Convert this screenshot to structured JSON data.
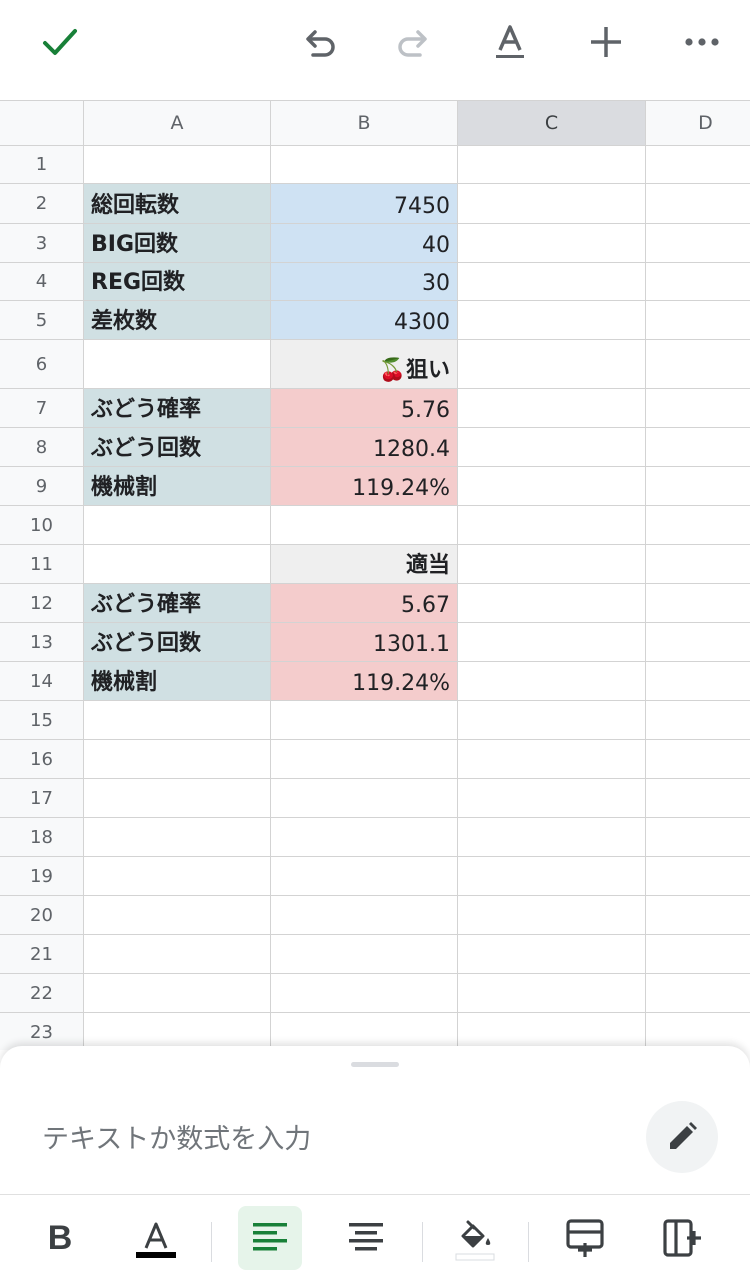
{
  "toolbar": {
    "done_icon": "check-icon",
    "undo_icon": "undo-icon",
    "redo_icon": "redo-icon",
    "text_format_icon": "text-format-icon",
    "insert_icon": "plus-icon",
    "more_icon": "more-horizontal-icon",
    "accent_color": "#188038"
  },
  "grid": {
    "columns": [
      "A",
      "B",
      "C",
      "D"
    ],
    "selected_column": "C",
    "rows": [
      {
        "num": "1",
        "a": "",
        "b": ""
      },
      {
        "num": "2",
        "a": "総回転数",
        "b": "7450"
      },
      {
        "num": "3",
        "a": "BIG回数",
        "b": "40"
      },
      {
        "num": "4",
        "a": "REG回数",
        "b": "30"
      },
      {
        "num": "5",
        "a": "差枚数",
        "b": "4300"
      },
      {
        "num": "6",
        "a": "",
        "b": "🍒狙い"
      },
      {
        "num": "7",
        "a": "ぶどう確率",
        "b": "5.76"
      },
      {
        "num": "8",
        "a": "ぶどう回数",
        "b": "1280.4"
      },
      {
        "num": "9",
        "a": "機械割",
        "b": "119.24%"
      },
      {
        "num": "10",
        "a": "",
        "b": ""
      },
      {
        "num": "11",
        "a": "",
        "b": "適当"
      },
      {
        "num": "12",
        "a": "ぶどう確率",
        "b": "5.67"
      },
      {
        "num": "13",
        "a": "ぶどう回数",
        "b": "1301.1"
      },
      {
        "num": "14",
        "a": "機械割",
        "b": "119.24%"
      },
      {
        "num": "15",
        "a": "",
        "b": ""
      },
      {
        "num": "16",
        "a": "",
        "b": ""
      },
      {
        "num": "17",
        "a": "",
        "b": ""
      },
      {
        "num": "18",
        "a": "",
        "b": ""
      },
      {
        "num": "19",
        "a": "",
        "b": ""
      },
      {
        "num": "20",
        "a": "",
        "b": ""
      },
      {
        "num": "21",
        "a": "",
        "b": ""
      },
      {
        "num": "22",
        "a": "",
        "b": ""
      },
      {
        "num": "23",
        "a": "",
        "b": ""
      }
    ],
    "colors": {
      "label_fill": "#d0e0e3",
      "input_fill": "#cfe2f3",
      "result_fill": "#f4cccc",
      "section_fill": "#efefef"
    }
  },
  "formula_bar": {
    "placeholder": "テキストか数式を入力",
    "edit_icon": "pencil-icon"
  },
  "format_bar": {
    "bold_label": "B",
    "text_color_icon": "text-color-icon",
    "align_left_icon": "align-left-icon",
    "align_center_icon": "align-center-icon",
    "fill_color_icon": "fill-color-icon",
    "insert_row_icon": "insert-row-icon",
    "insert_column_icon": "insert-column-icon",
    "active_color": "#e6f4ea"
  }
}
